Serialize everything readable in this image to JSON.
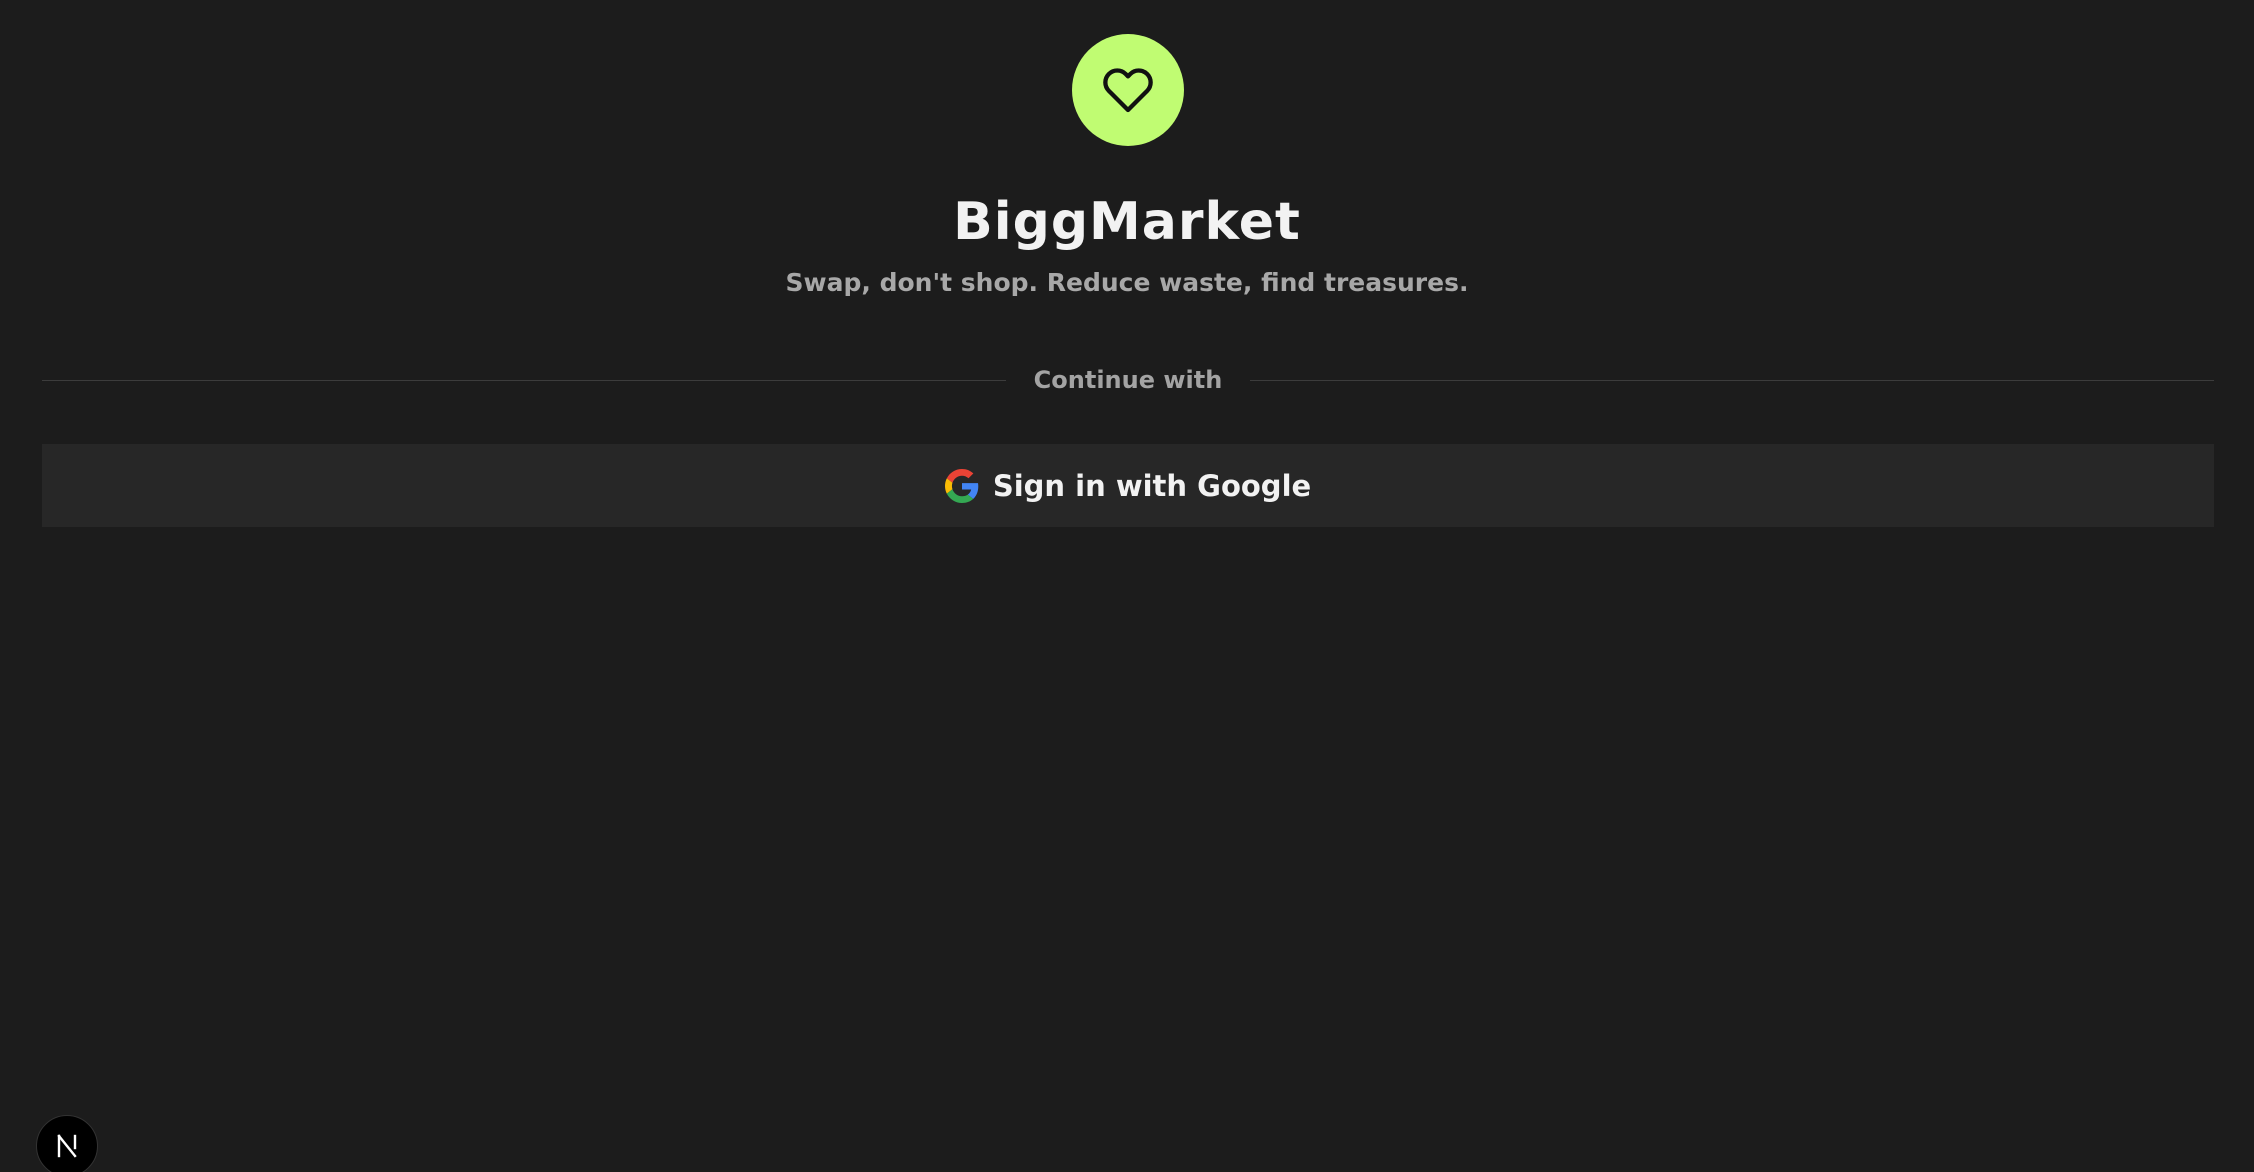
{
  "app": {
    "title": "BiggMarket",
    "tagline": "Swap, don't shop. Reduce waste, find treasures.",
    "logo_icon": "heart-icon"
  },
  "auth": {
    "divider_text": "Continue with",
    "google_button_label": "Sign in with Google",
    "google_icon": "google-icon"
  },
  "dev_badge": {
    "icon": "nextjs-logo-icon"
  },
  "colors": {
    "background": "#1c1c1c",
    "accent": "#c0fc72",
    "button_background": "#272727",
    "title_text": "#f2f2f2",
    "muted_text": "#a8a8a8"
  }
}
